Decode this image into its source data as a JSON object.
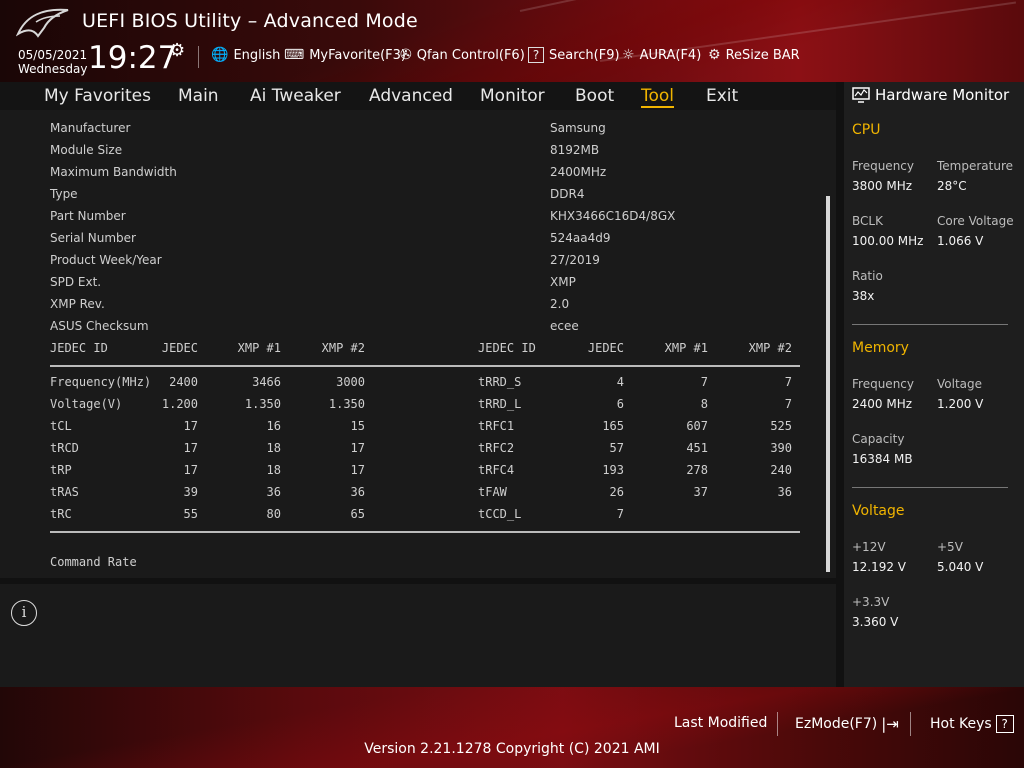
{
  "header": {
    "title": "UEFI BIOS Utility – Advanced Mode",
    "date": "05/05/2021",
    "day": "Wednesday",
    "time": "19:27",
    "tools": [
      {
        "icon": "globe-icon",
        "label": "English"
      },
      {
        "icon": "keyboard-icon",
        "label": "MyFavorite(F3)"
      },
      {
        "icon": "fan-icon",
        "label": "Qfan Control(F6)"
      },
      {
        "icon": "help-icon",
        "label": "Search(F9)"
      },
      {
        "icon": "aura-light-icon",
        "label": "AURA(F4)"
      },
      {
        "icon": "resize-bar-icon",
        "label": "ReSize BAR"
      }
    ]
  },
  "nav": {
    "tabs": [
      "My Favorites",
      "Main",
      "Ai Tweaker",
      "Advanced",
      "Monitor",
      "Boot",
      "Tool",
      "Exit"
    ],
    "active": "Tool"
  },
  "spd_info": [
    {
      "label": "Manufacturer",
      "value": "Samsung"
    },
    {
      "label": "Module Size",
      "value": "8192MB"
    },
    {
      "label": "Maximum Bandwidth",
      "value": "2400MHz"
    },
    {
      "label": "Type",
      "value": "DDR4"
    },
    {
      "label": "Part Number",
      "value": "KHX3466C16D4/8GX"
    },
    {
      "label": "Serial Number",
      "value": "524aa4d9"
    },
    {
      "label": "Product Week/Year",
      "value": "27/2019"
    },
    {
      "label": "SPD Ext.",
      "value": "XMP"
    },
    {
      "label": "XMP Rev.",
      "value": "2.0"
    },
    {
      "label": "ASUS Checksum",
      "value": "ecee"
    }
  ],
  "timing_table": {
    "headers": [
      "JEDEC ID",
      "JEDEC",
      "XMP #1",
      "XMP #2"
    ],
    "left_rows": [
      [
        "Frequency(MHz)",
        "2400",
        "3466",
        "3000"
      ],
      [
        "Voltage(V)",
        "1.200",
        "1.350",
        "1.350"
      ],
      [
        "tCL",
        "17",
        "16",
        "15"
      ],
      [
        "tRCD",
        "17",
        "18",
        "17"
      ],
      [
        "tRP",
        "17",
        "18",
        "17"
      ],
      [
        "tRAS",
        "39",
        "36",
        "36"
      ],
      [
        "tRC",
        "55",
        "80",
        "65"
      ]
    ],
    "right_rows": [
      [
        "tRRD_S",
        "4",
        "7",
        "7"
      ],
      [
        "tRRD_L",
        "6",
        "8",
        "7"
      ],
      [
        "tRFC1",
        "165",
        "607",
        "525"
      ],
      [
        "tRFC2",
        "57",
        "451",
        "390"
      ],
      [
        "tRFC4",
        "193",
        "278",
        "240"
      ],
      [
        "tFAW",
        "26",
        "37",
        "36"
      ],
      [
        "tCCD_L",
        "7",
        "",
        ""
      ]
    ],
    "footer_label": "Command Rate"
  },
  "hardware_monitor": {
    "title": "Hardware Monitor",
    "cpu": {
      "heading": "CPU",
      "frequency_label": "Frequency",
      "frequency": "3800 MHz",
      "temperature_label": "Temperature",
      "temperature": "28°C",
      "bclk_label": "BCLK",
      "bclk": "100.00 MHz",
      "core_voltage_label": "Core Voltage",
      "core_voltage": "1.066 V",
      "ratio_label": "Ratio",
      "ratio": "38x"
    },
    "memory": {
      "heading": "Memory",
      "frequency_label": "Frequency",
      "frequency": "2400 MHz",
      "voltage_label": "Voltage",
      "voltage": "1.200 V",
      "capacity_label": "Capacity",
      "capacity": "16384 MB"
    },
    "voltage": {
      "heading": "Voltage",
      "v12_label": "+12V",
      "v12": "12.192 V",
      "v5_label": "+5V",
      "v5": "5.040 V",
      "v33_label": "+3.3V",
      "v33": "3.360 V"
    }
  },
  "footer": {
    "last_modified": "Last Modified",
    "ezmode": "EzMode(F7)",
    "hotkeys": "Hot Keys",
    "hotkeys_key": "?",
    "version": "Version 2.21.1278 Copyright (C) 2021 AMI"
  },
  "colors": {
    "accent": "#f0b400",
    "panel": "#1a1a1a",
    "header_red": "#8c1015"
  }
}
